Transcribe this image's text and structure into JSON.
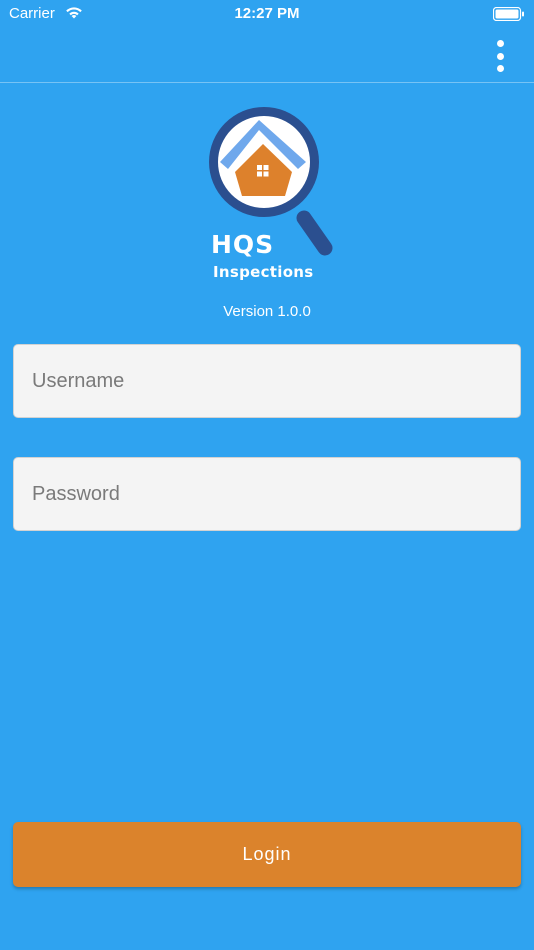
{
  "status_bar": {
    "carrier": "Carrier",
    "time": "12:27 PM",
    "wifi_icon": "wifi-icon",
    "battery_icon": "battery-icon"
  },
  "nav_bar": {
    "menu_icon": "more-vertical-icon"
  },
  "logo": {
    "title": "HQS",
    "subtitle": "Inspections",
    "icon": "house-magnifier-icon",
    "colors": {
      "ring": "#2b4f8f",
      "roof": "#6fa8ec",
      "house": "#dd812c"
    }
  },
  "version_label": "Version 1.0.0",
  "form": {
    "username_placeholder": "Username",
    "username_value": "",
    "password_placeholder": "Password",
    "password_value": ""
  },
  "login_button": "Login",
  "colors": {
    "background": "#2fa3f0",
    "accent": "#db832c",
    "field_bg": "#f4f4f4"
  }
}
